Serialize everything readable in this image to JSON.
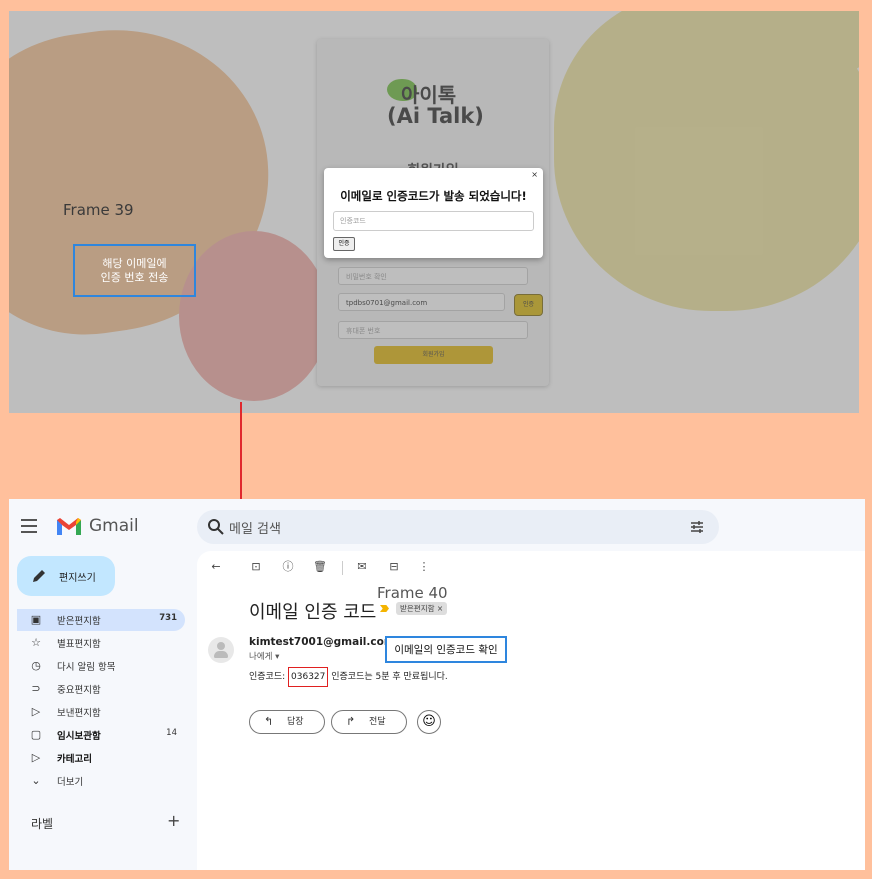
{
  "top_frame": {
    "frame_label": "Frame 39",
    "logo": {
      "line1": "아이톡",
      "line2": "(Ai Talk)"
    },
    "signup_title": "회원가입",
    "fields": {
      "password_confirm_placeholder": "비밀번호 확인",
      "email_value": "tpdbs0701@gmail.com",
      "phone_placeholder": "휴대폰 번호"
    },
    "verify_button": "인증",
    "submit_button": "회원가입",
    "modal": {
      "close": "×",
      "title": "이메일로 인증코드가 발송 되었습니다!",
      "code_placeholder": "인증코드",
      "confirm_button": "인증"
    },
    "note": {
      "line1": "해당 이메일에",
      "line2": "인증 번호 전송"
    }
  },
  "gmail": {
    "brand": "Gmail",
    "search_placeholder": "메일 검색",
    "compose": "편지쓰기",
    "nav": [
      {
        "icon": "inbox-icon",
        "label": "받은편지함",
        "count": "731",
        "active": true
      },
      {
        "icon": "star-icon",
        "label": "별표편지함"
      },
      {
        "icon": "clock-icon",
        "label": "다시 알림 항목"
      },
      {
        "icon": "important-icon",
        "label": "중요편지함"
      },
      {
        "icon": "send-icon",
        "label": "보낸편지함"
      },
      {
        "icon": "draft-icon",
        "label": "임시보관함",
        "count": "14",
        "bold": true
      },
      {
        "icon": "category-icon",
        "label": "카테고리",
        "bold": true
      },
      {
        "icon": "chevron-down-icon",
        "label": "더보기"
      }
    ],
    "labels_heading": "라벨",
    "labels_add": "+",
    "frame_label": "Frame 40",
    "message": {
      "subject": "이메일 인증 코드",
      "chip": "받은편지함 ×",
      "sender": "kimtest7001@gmail.com",
      "to": "나에게 ▾",
      "body_prefix": "인증코드: ",
      "code": "036327",
      "body_suffix": " 인증코드는 5분 후 만료됩니다."
    },
    "note": "이메일의 인증코드 확인",
    "reply": "답장",
    "forward": "전달"
  },
  "colors": {
    "background": "#ffc09c",
    "arrow": "#e0282d",
    "note_border": "#2e86de",
    "compose_bg": "#c2e7ff",
    "active_nav": "#d3e3fd",
    "submit": "#e0b300"
  }
}
